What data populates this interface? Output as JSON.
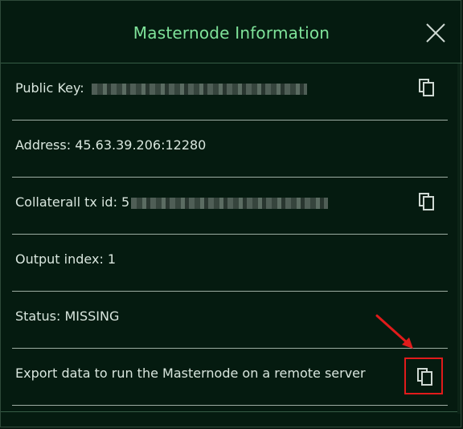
{
  "dialog": {
    "title": "Masternode Information",
    "close_icon": "close-icon"
  },
  "rows": [
    {
      "label": "Public Key:",
      "value": "",
      "redacted": true,
      "has_copy": true
    },
    {
      "label": "Address: 45.63.39.206:12280",
      "has_copy": false
    },
    {
      "label": "Collaterall tx id: 5",
      "value": "",
      "redacted": true,
      "has_copy": true
    },
    {
      "label": "Output index: 1",
      "has_copy": false
    },
    {
      "label": "Status: MISSING",
      "has_copy": false
    },
    {
      "label": "Export data to run the Masternode on a remote server",
      "has_copy": true,
      "highlighted": true
    }
  ],
  "colors": {
    "background": "#051b10",
    "title": "#7fe39a",
    "text": "#d9e6de",
    "highlight": "#e11b1b"
  },
  "icons": {
    "copy": "copy-icon",
    "annotation_arrow": "arrow-icon"
  }
}
